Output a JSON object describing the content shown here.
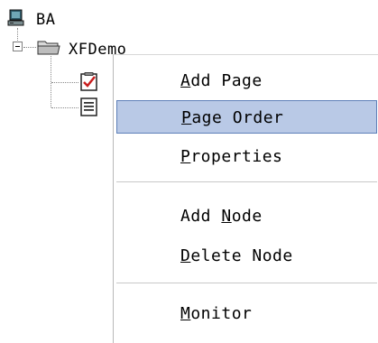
{
  "tree": {
    "root": {
      "label": "BA",
      "icon": "computer-icon"
    },
    "folder": {
      "label": "XFDemo",
      "icon": "folder-icon",
      "expanded": true
    },
    "children": [
      {
        "icon": "checklist-icon"
      },
      {
        "icon": "document-icon"
      }
    ]
  },
  "context_menu": {
    "items": [
      {
        "label_mnemonic": "A",
        "label_rest": "dd Page",
        "selected": false
      },
      {
        "label_mnemonic": "P",
        "label_rest": "age Order",
        "selected": true
      },
      {
        "label_mnemonic": "P",
        "label_rest": "roperties",
        "selected": false
      },
      {
        "label_prefix": "Add ",
        "label_mnemonic": "N",
        "label_rest": "ode",
        "selected": false
      },
      {
        "label_mnemonic": "D",
        "label_rest": "elete Node",
        "selected": false
      },
      {
        "label_mnemonic": "M",
        "label_rest": "onitor",
        "selected": false
      }
    ]
  },
  "colors": {
    "selection_fill": "#b9c9e6",
    "selection_border": "#5d7fb8"
  }
}
